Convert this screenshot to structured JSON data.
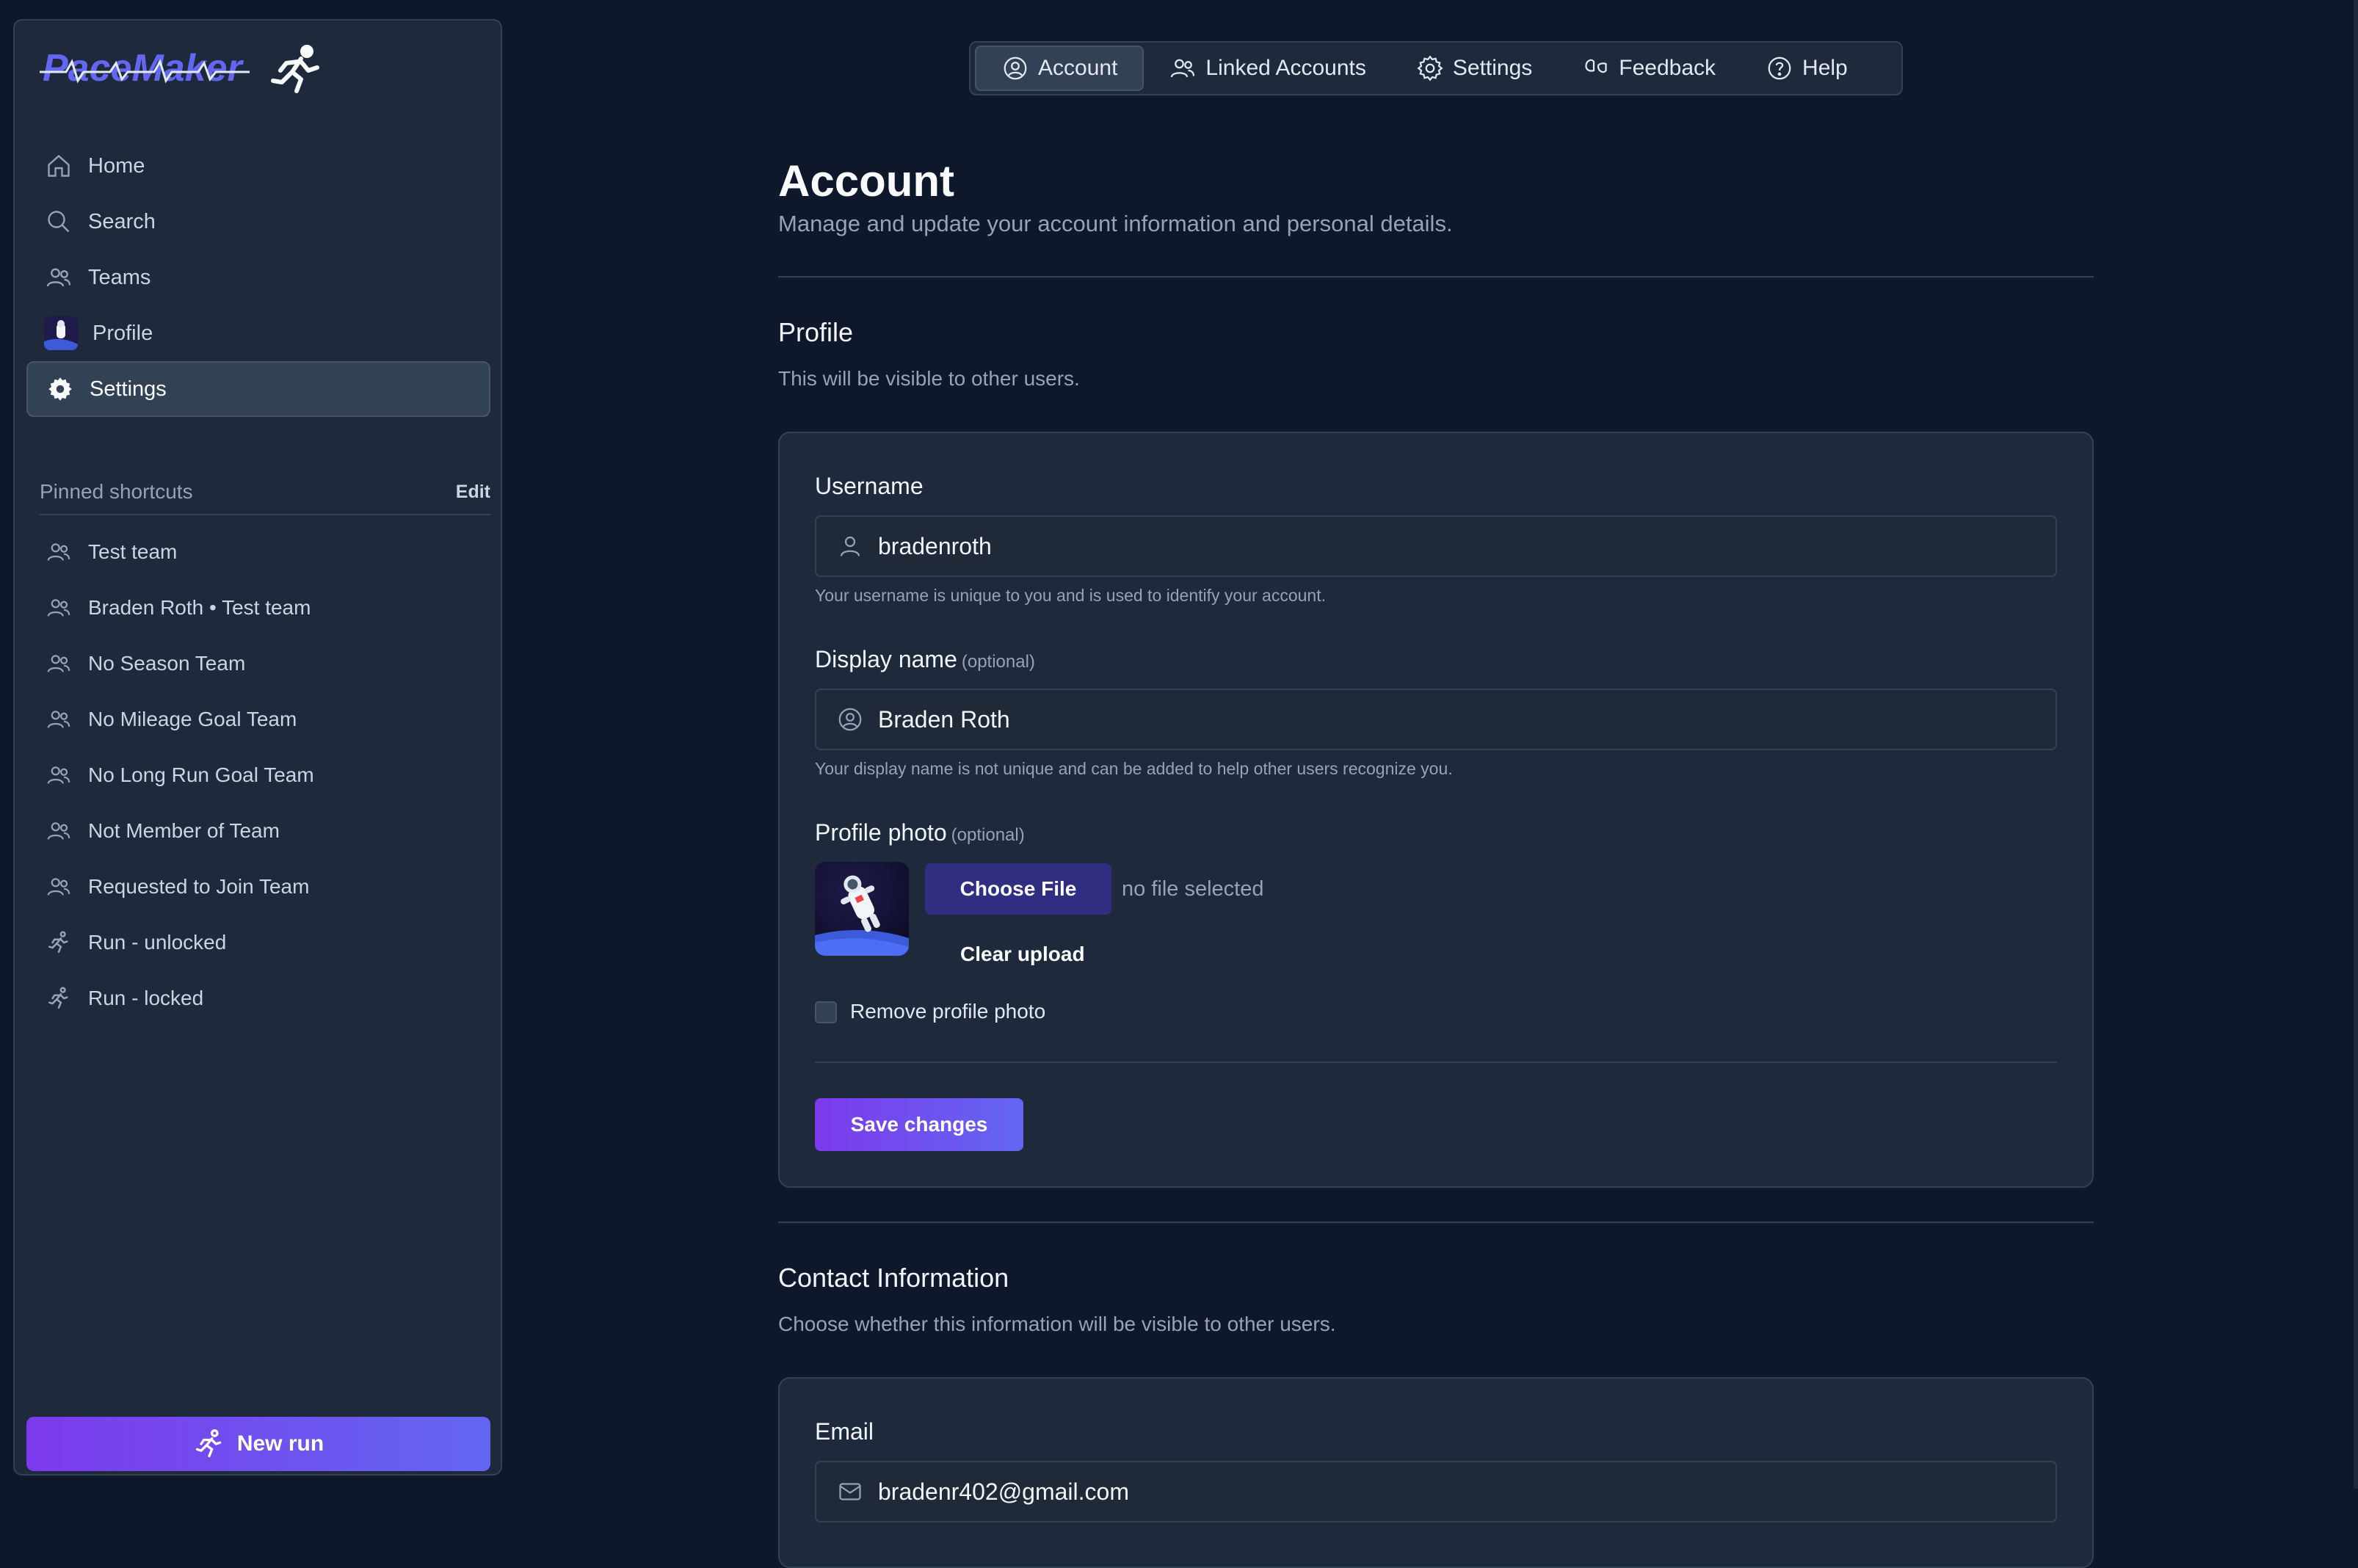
{
  "app": {
    "logo_text": "PaceMaker"
  },
  "sidebar": {
    "nav": [
      {
        "label": "Home",
        "icon": "home-icon"
      },
      {
        "label": "Search",
        "icon": "search-icon"
      },
      {
        "label": "Teams",
        "icon": "users-icon"
      },
      {
        "label": "Profile",
        "icon": "avatar"
      },
      {
        "label": "Settings",
        "icon": "gear-icon",
        "active": true
      }
    ],
    "pinned_heading": "Pinned shortcuts",
    "pinned_edit": "Edit",
    "pinned": [
      {
        "label": "Test team",
        "icon": "users-icon"
      },
      {
        "label": "Braden Roth • Test team",
        "icon": "users-icon"
      },
      {
        "label": "No Season Team",
        "icon": "users-icon"
      },
      {
        "label": "No Mileage Goal Team",
        "icon": "users-icon"
      },
      {
        "label": "No Long Run Goal Team",
        "icon": "users-icon"
      },
      {
        "label": "Not Member of Team",
        "icon": "users-icon"
      },
      {
        "label": "Requested to Join Team",
        "icon": "users-icon"
      },
      {
        "label": "Run - unlocked",
        "icon": "runner-icon"
      },
      {
        "label": "Run - locked",
        "icon": "runner-icon"
      }
    ],
    "new_run": "New run"
  },
  "tabs": [
    {
      "label": "Account",
      "icon": "user-circle-icon",
      "active": true
    },
    {
      "label": "Linked Accounts",
      "icon": "users-icon"
    },
    {
      "label": "Settings",
      "icon": "gear-icon"
    },
    {
      "label": "Feedback",
      "icon": "feedback-icon"
    },
    {
      "label": "Help",
      "icon": "help-icon"
    }
  ],
  "page": {
    "title": "Account",
    "subtitle": "Manage and update your account information and personal details."
  },
  "profile": {
    "title": "Profile",
    "subtitle": "This will be visible to other users.",
    "username_label": "Username",
    "username_value": "bradenroth",
    "username_help": "Your username is unique to you and is used to identify your account.",
    "display_label": "Display name",
    "display_optional": "(optional)",
    "display_value": "Braden Roth",
    "display_help": "Your display name is not unique and can be added to help other users recognize you.",
    "photo_label": "Profile photo",
    "photo_optional": "(optional)",
    "choose_file": "Choose File",
    "no_file": "no file selected",
    "clear_upload": "Clear upload",
    "remove_photo": "Remove profile photo",
    "save": "Save changes"
  },
  "contact": {
    "title": "Contact Information",
    "subtitle": "Choose whether this information will be visible to other users.",
    "email_label": "Email",
    "email_value": "bradenr402@gmail.com"
  },
  "colors": {
    "background": "#0f172a",
    "surface": "#1e293b",
    "accent": "#7c3aed",
    "choose_button": "#312e81"
  }
}
